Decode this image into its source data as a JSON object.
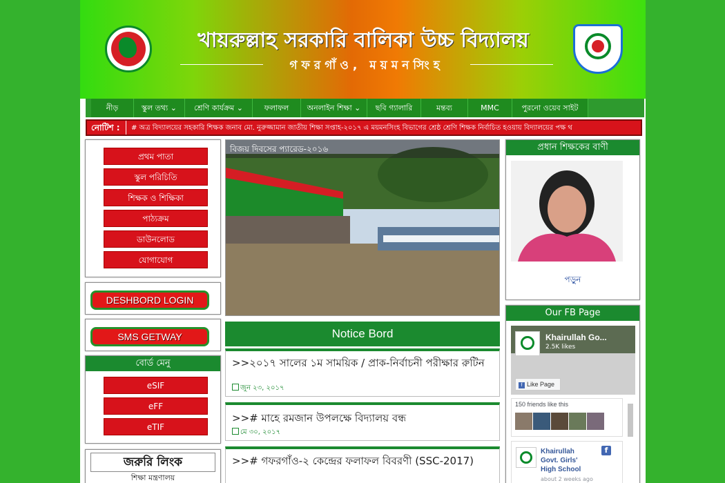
{
  "header": {
    "title": "খায়রুল্লাহ সরকারি বালিকা উচ্চ বিদ্যালয়",
    "subtitle": "গফরগাঁও, ময়মনসিংহ"
  },
  "nav": {
    "items": [
      {
        "label": "নীড়"
      },
      {
        "label": "স্কুল তথ্য ⌄"
      },
      {
        "label": "শ্রেণি কার্যক্রম ⌄"
      },
      {
        "label": "ফলাফল"
      },
      {
        "label": "অনলাইন শিক্ষা ⌄"
      },
      {
        "label": "ছবি গ্যালারি"
      },
      {
        "label": "মন্তব্য"
      },
      {
        "label": "MMC"
      },
      {
        "label": "পুরনো ওয়েব সাইট"
      }
    ]
  },
  "notice_bar": {
    "label": "নোটিশ :",
    "text": "# অত্র বিদ্যালয়ের সহকারি শিক্ষক জনাব মো. নুরুজ্জামান জাতীয় শিক্ষা সপ্তাহ-২০১৭ এ ময়মনসিংহ বিভাগের শ্রেষ্ঠ শ্রেণি শিক্ষক নির্বাচিত হওয়ায় বিদ্যালয়ের পক্ষ থ"
  },
  "sidebar": {
    "menu": [
      {
        "label": "প্রথম পাতা"
      },
      {
        "label": "স্কুল পরিচিতি"
      },
      {
        "label": "শিক্ষক ও শিক্ষিকা"
      },
      {
        "label": "পাঠ্যক্রম"
      },
      {
        "label": "ডাউনলোড"
      },
      {
        "label": "যোগাযোগ"
      }
    ],
    "dashboard_label": "DESHBORD LOGIN",
    "sms_label": "SMS GETWAY",
    "board_menu": {
      "title": "বোর্ড মেনু",
      "items": [
        {
          "label": "eSIF"
        },
        {
          "label": "eFF"
        },
        {
          "label": "eTIF"
        }
      ]
    },
    "links": {
      "title": "জরুরি লিংক",
      "first": "শিক্ষা মন্ত্রণালয়"
    }
  },
  "slider": {
    "caption": "বিজয় দিবসের প্যারেড-২০১৬"
  },
  "notice_board": {
    "title": "Notice Bord",
    "items": [
      {
        "title": ">>২০১৭ সালের ১ম সাময়িক / প্রাক-নির্বাচনী পরীক্ষার রুটিন",
        "date": "জুন ২৩, ২০১৭"
      },
      {
        "title": ">># মাহে রমজান উপলক্ষে বিদ্যালয় বন্ধ",
        "date": "মে ৩০, ২০১৭"
      },
      {
        "title": ">># গফরগাঁও-২ কেন্দ্রের ফলাফল বিবরণী (SSC-2017)",
        "date": ""
      }
    ]
  },
  "head_teacher": {
    "title": "প্রধান শিক্ষকের বাণী",
    "read_more": "পড়ুন"
  },
  "fb": {
    "title": "Our FB Page",
    "page_name": "Khairullah Go...",
    "likes": "2.5K likes",
    "like_button": "Like Page",
    "friends": "150 friends like this",
    "post_name_1": "Khairullah",
    "post_name_2": "Govt. Girls'",
    "post_name_3": "High School",
    "post_time": "about 2 weeks ago"
  },
  "colors": {
    "nav_green": "#1f8b1f",
    "notice_red": "#d7131b",
    "accent_green": "#1b8a2f",
    "page_bg": "#34b22d"
  }
}
